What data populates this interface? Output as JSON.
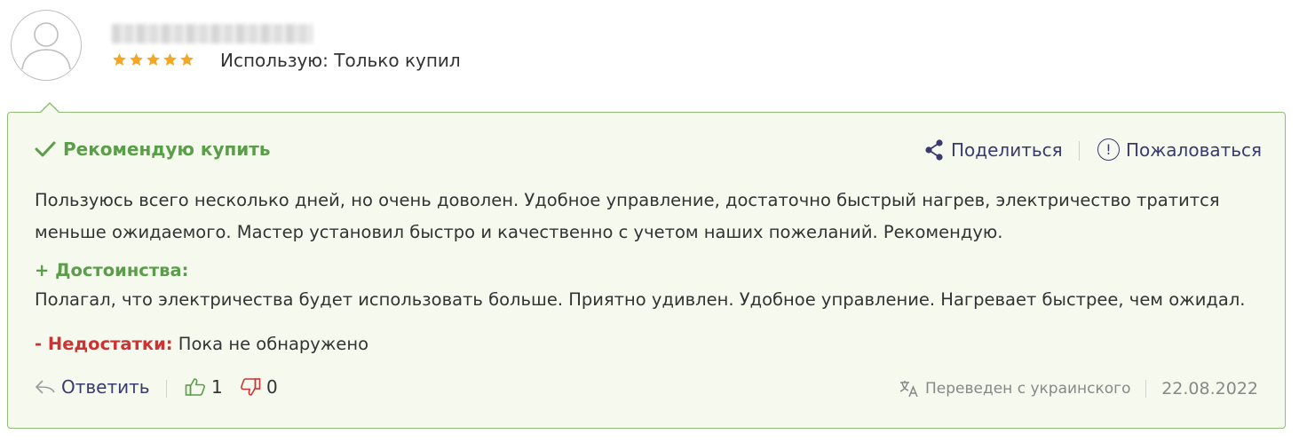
{
  "review": {
    "author_name": "████████████",
    "rating": 5,
    "rating_max": 5,
    "usage": "Использую: Только купил",
    "recommend_label": "Рекомендую купить",
    "share_label": "Поделиться",
    "complain_label": "Пожаловаться",
    "complain_icon_glyph": "!",
    "text": "Пользуюсь всего несколько дней, но очень доволен. Удобное управление, достаточно быстрый нагрев, электричество тратится меньше ожидаемого. Мастер установил быстро и качественно с учетом наших пожеланий. Рекомендую.",
    "advantages_label": "+ Достоинства:",
    "advantages_text": "Полагал, что электричества будет использовать больше. Приятно удивлен. Удобное управление. Нагревает быстрее, чем ожидал.",
    "disadvantages_label": "- Недостатки:",
    "disadvantages_text": "Пока не обнаружено",
    "reply_label": "Ответить",
    "likes": "1",
    "dislikes": "0",
    "translated_label": "Переведен с украинского",
    "date": "22.08.2022"
  },
  "icons": {
    "avatar": "user-avatar-icon",
    "star": "star-icon",
    "check": "check-icon",
    "share": "share-icon",
    "complain": "exclamation-circle-icon",
    "reply": "reply-arrow-icon",
    "like": "thumbs-up-icon",
    "dislike": "thumbs-down-icon",
    "translate": "translate-icon"
  },
  "colors": {
    "star": "#f5a623",
    "recommend": "#5a9e4a",
    "advantages": "#5a9e4a",
    "disadvantages": "#cc3333",
    "link": "#3a3a6e",
    "card_background": "#f6f9ee",
    "card_border": "#8fbf74",
    "muted_text": "#888888"
  }
}
